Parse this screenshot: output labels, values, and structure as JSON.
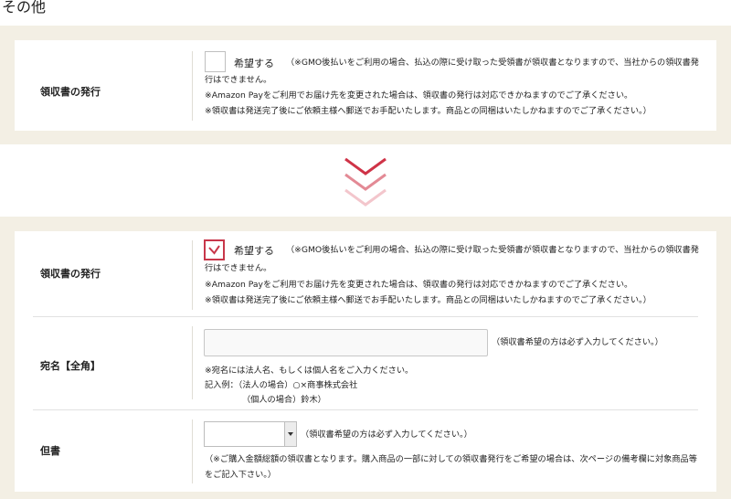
{
  "page_title": "その他",
  "receipt": {
    "label": "領収書の発行",
    "checkbox_label": "希望する",
    "note_line1": "（※GMO後払いをご利用の場合、払込の際に受け取った受領書が領収書となりますので、当社からの領収書発",
    "note_line2": "行はできません。",
    "note_line3": "※Amazon Payをご利用でお届け先を変更された場合は、領収書の発行は対応できかねますのでご了承ください。",
    "note_line4": "※領収書は発送完了後にご依頼主様へ郵送でお手配いたします。商品との同梱はいたしかねますのでご了承ください。）"
  },
  "before": {
    "checked": false
  },
  "after": {
    "checked": true
  },
  "transition_icon": "chevron-down-double-icon",
  "addressee": {
    "label": "宛名【全角】",
    "value": "",
    "hint": "（領収書希望の方は必ず入力してください。）",
    "note_line1": "※宛名には法人名、もしくは個人名をご入力ください。",
    "example_line1": "記入例：（法人の場合）○×商事株式会社",
    "example_line2": "（個人の場合）鈴木）"
  },
  "proviso": {
    "label": "但書",
    "selected": "",
    "hint": "（領収書希望の方は必ず入力してください。）",
    "note_line1": "（※ご購入金額総額の領収書となります。購入商品の一部に対しての領収書発行をご希望の場合は、次ページの備考欄に対象商品等",
    "note_line2": "をご記入下さい。）"
  },
  "colors": {
    "panel_bg": "#f3efe4",
    "accent": "#c8374a"
  }
}
